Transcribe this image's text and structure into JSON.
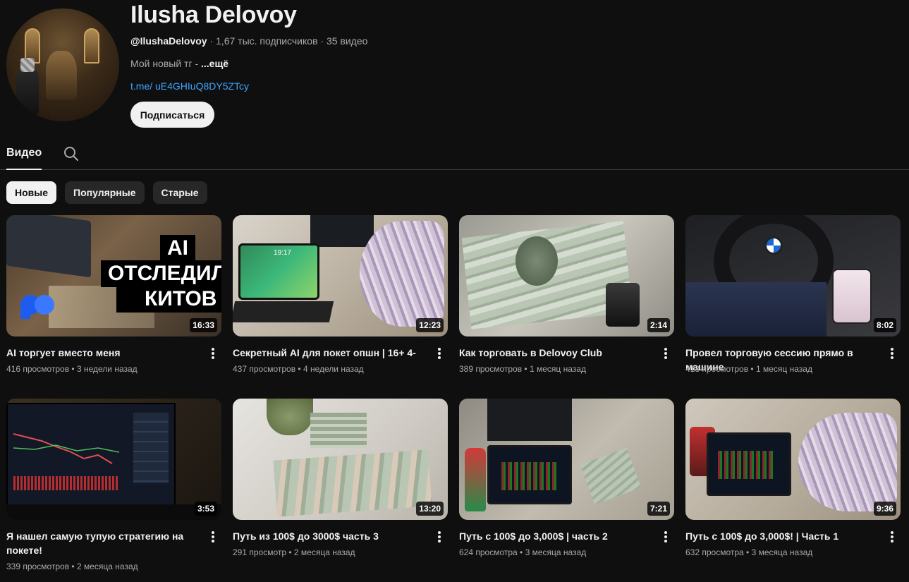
{
  "channel": {
    "name": "Ilusha Delovoy",
    "handle": "@IlushaDelovoy",
    "meta_rest": " · 1,67 тыс. подписчиков · 35 видео",
    "description": "Мой новый тг - ",
    "more_label": "...ещё",
    "link": "t.me/ uE4GHIuQ8DY5ZTcy",
    "subscribe_label": "Подписаться"
  },
  "tabs": {
    "videos_label": "Видео",
    "search_icon": "search-icon"
  },
  "chips": [
    {
      "label": "Новые",
      "active": true
    },
    {
      "label": "Популярные",
      "active": false
    },
    {
      "label": "Старые",
      "active": false
    }
  ],
  "thumb_overlay": {
    "line1": "AI",
    "line2": "ОТСЛЕДИЛ",
    "line3": "КИТОВ",
    "laptop_time": "19:17"
  },
  "videos": [
    {
      "title": "AI торгует вместо меня",
      "duration": "16:33",
      "views": "416 просмотров",
      "age": "3 недели назад"
    },
    {
      "title": "Секретный AI для покет опшн | 16+ 4-",
      "duration": "12:23",
      "views": "437 просмотров",
      "age": "4 недели назад"
    },
    {
      "title": "Как торговать в Delovoy Club",
      "duration": "2:14",
      "views": "389 просмотров",
      "age": "1 месяц назад"
    },
    {
      "title": "Провел торговую сессию прямо в машине",
      "duration": "8:02",
      "views": "418 просмотров",
      "age": "1 месяц назад"
    },
    {
      "title": "Я нашел самую тупую стратегию на покете!",
      "duration": "3:53",
      "views": "339 просмотров",
      "age": "2 месяца назад"
    },
    {
      "title": "Путь из 100$ до 3000$ часть 3",
      "duration": "13:20",
      "views": "291 просмотр",
      "age": "2 месяца назад"
    },
    {
      "title": "Путь с 100$ до 3,000$ | часть 2",
      "duration": "7:21",
      "views": "624 просмотра",
      "age": "3 месяца назад"
    },
    {
      "title": "Путь с 100$ до 3,000$! | Часть 1",
      "duration": "9:36",
      "views": "632 просмотра",
      "age": "3 месяца назад"
    }
  ],
  "colors": {
    "background": "#0f0f0f",
    "link": "#3ea6ff",
    "chip": "#272727",
    "secondary_text": "#aaaaaa"
  }
}
